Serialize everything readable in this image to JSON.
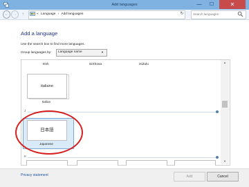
{
  "window": {
    "title": "Add languages",
    "min_glyph": "—",
    "max_glyph": "☐",
    "close_glyph": "✕"
  },
  "addressbar": {
    "back_glyph": "←",
    "forward_glyph": "→",
    "up_glyph": "↑",
    "crumbs": [
      "«",
      "Language",
      "›",
      "Add languages"
    ],
    "refresh_glyph": "↻",
    "search_placeholder": "Search languages"
  },
  "content": {
    "heading": "Add a language",
    "instruction": "Use the search box to find more languages.",
    "group_label": "Group languages by:",
    "group_value": "Language name",
    "group_arrow": "▼"
  },
  "languages": {
    "top_row": [
      "Irish",
      "isiXhosa",
      "isiZulu"
    ],
    "italian_tile": "italiano",
    "italian_caption": "Italian",
    "section_j": "J",
    "japanese_tile": "日本語",
    "japanese_caption": "Japanese",
    "section_k": "K"
  },
  "scrollbar": {
    "up_glyph": "▲",
    "down_glyph": "▼"
  },
  "footer": {
    "privacy_link": "Privacy statement",
    "add_button": "Add",
    "cancel_button": "Cancel"
  },
  "colors": {
    "titlebar": "#7fb2e0",
    "close_button": "#c74b4b",
    "heading": "#1e3287",
    "selection": "#d9ebf9",
    "annotation_ellipse": "#d61e1e",
    "link": "#1e56a6"
  }
}
